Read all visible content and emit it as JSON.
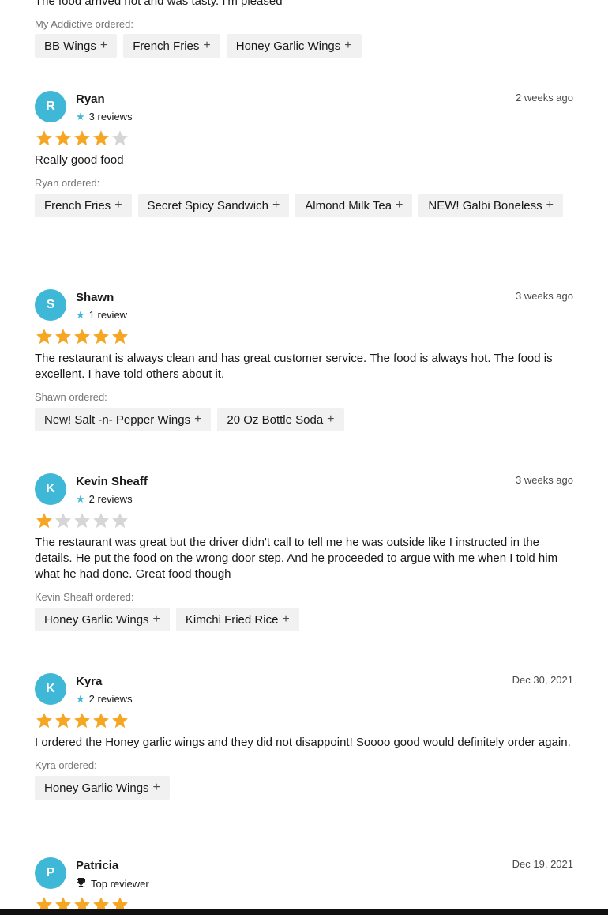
{
  "top_partial": {
    "text": "The food arrived hot and was tasty. I'm pleased",
    "ordered_label": "My Addictive ordered:",
    "items": [
      "BB Wings",
      "French Fries",
      "Honey Garlic Wings"
    ]
  },
  "icons": {
    "star_filled_color": "#f5a623",
    "star_empty_color": "#d6d6d6",
    "avatar_color": "#3fb8d8"
  },
  "reviews": [
    {
      "initial": "R",
      "name": "Ryan",
      "reviews_count": "3 reviews",
      "date": "2 weeks ago",
      "rating": 4,
      "text": "Really good food",
      "ordered_label": "Ryan ordered:",
      "items": [
        "French Fries",
        "Secret Spicy Sandwich",
        "Almond Milk Tea",
        "NEW! Galbi Boneless"
      ]
    },
    {
      "initial": "S",
      "name": "Shawn",
      "reviews_count": "1 review",
      "date": "3 weeks ago",
      "rating": 5,
      "text": "The restaurant is always clean and has great customer service. The food is always hot. The food is excellent. I have told others about it.",
      "ordered_label": "Shawn ordered:",
      "items": [
        "New! Salt -n- Pepper Wings",
        "20 Oz Bottle Soda"
      ]
    },
    {
      "initial": "K",
      "name": "Kevin Sheaff",
      "reviews_count": "2 reviews",
      "date": "3 weeks ago",
      "rating": 1,
      "text": "The restaurant was great but the driver didn't call to tell me he was outside like I instructed in the details. He put the food on the wrong door step. And he proceeded to argue with me when I told him what he had done. Great food though",
      "ordered_label": "Kevin Sheaff ordered:",
      "items": [
        "Honey Garlic Wings",
        "Kimchi Fried Rice"
      ]
    },
    {
      "initial": "K",
      "name": "Kyra",
      "reviews_count": "2 reviews",
      "date": "Dec 30, 2021",
      "rating": 5,
      "text": "I ordered the Honey garlic wings and they did not disappoint! Soooo good would definitely order again.",
      "ordered_label": "Kyra ordered:",
      "items": [
        "Honey Garlic Wings"
      ]
    },
    {
      "initial": "P",
      "name": "Patricia",
      "reviews_count": "Top reviewer",
      "date": "Dec 19, 2021",
      "rating": 5,
      "text": "",
      "ordered_label": "",
      "items": []
    }
  ],
  "labels": {
    "plus": "+",
    "star_icon": "★"
  }
}
